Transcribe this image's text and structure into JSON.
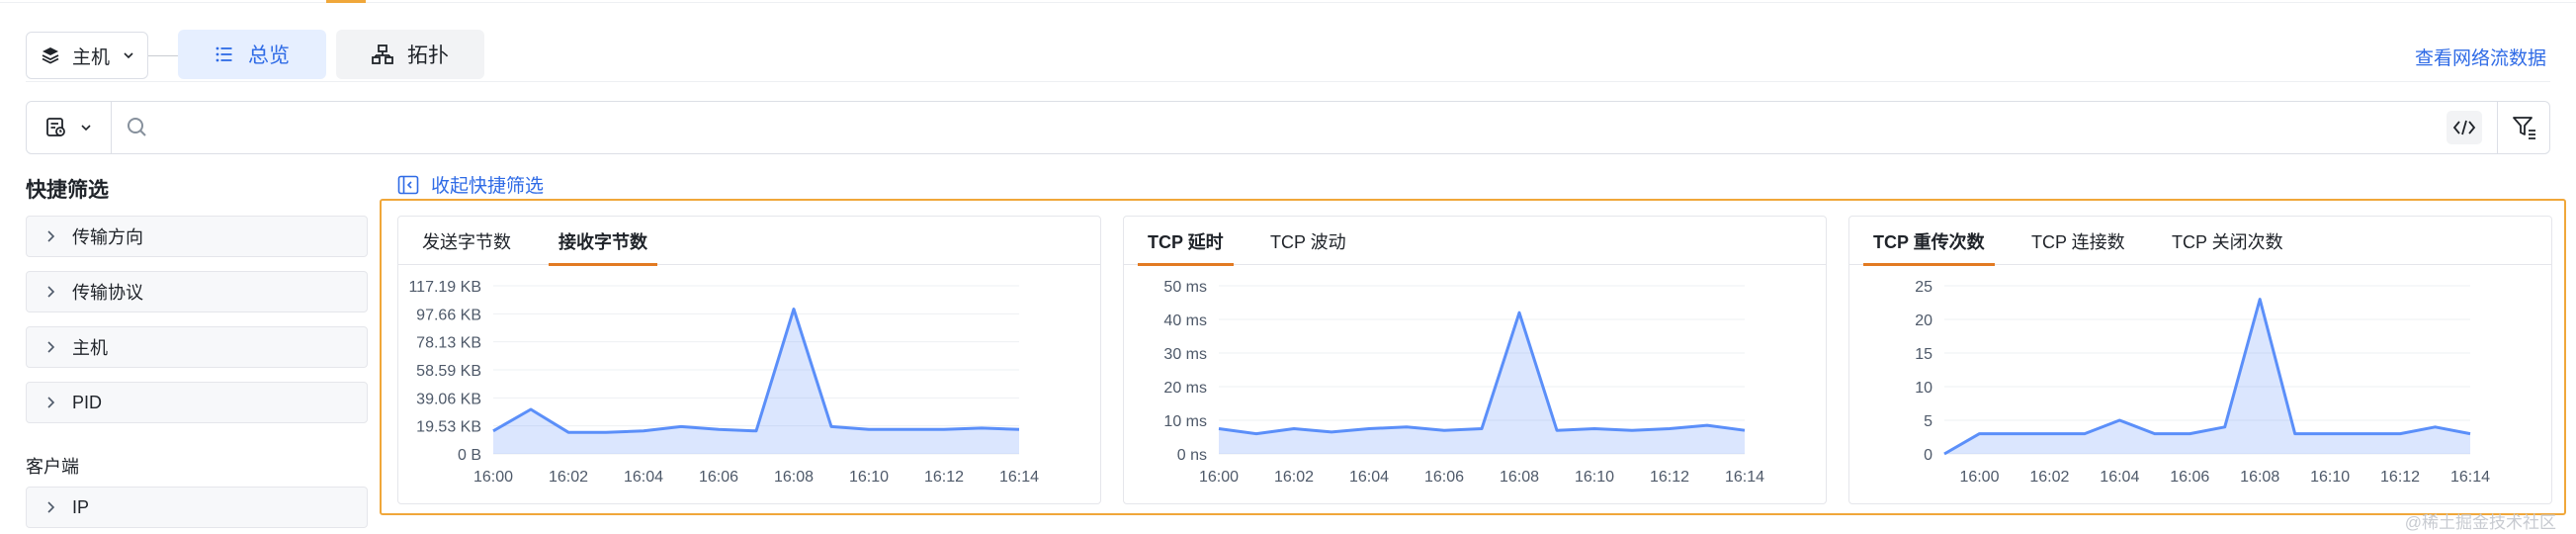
{
  "header": {
    "host_select": "主机",
    "tabs": [
      {
        "label": "总览",
        "active": true
      },
      {
        "label": "拓扑",
        "active": false
      }
    ],
    "flow_link": "查看网络流数据"
  },
  "search": {
    "placeholder": ""
  },
  "sidebar": {
    "title": "快捷筛选",
    "items": [
      {
        "label": "传输方向"
      },
      {
        "label": "传输协议"
      },
      {
        "label": "主机"
      },
      {
        "label": "PID"
      }
    ],
    "client_title": "客户端",
    "client_items": [
      {
        "label": "IP"
      }
    ]
  },
  "collapse_label": "收起快捷筛选",
  "cards": [
    {
      "tabs": [
        {
          "label": "发送字节数",
          "active": false
        },
        {
          "label": "接收字节数",
          "active": true
        }
      ]
    },
    {
      "tabs": [
        {
          "label": "TCP 延时",
          "active": true
        },
        {
          "label": "TCP 波动",
          "active": false
        }
      ]
    },
    {
      "tabs": [
        {
          "label": "TCP 重传次数",
          "active": true
        },
        {
          "label": "TCP 连接数",
          "active": false
        },
        {
          "label": "TCP 关闭次数",
          "active": false
        }
      ]
    }
  ],
  "chart_data": [
    {
      "type": "area",
      "title": "",
      "x": [
        "16:00",
        "16:01",
        "16:02",
        "16:03",
        "16:04",
        "16:05",
        "16:06",
        "16:07",
        "16:08",
        "16:09",
        "16:10",
        "16:11",
        "16:12",
        "16:13",
        "16:14"
      ],
      "y_ticks": [
        "0 B",
        "19.53 KB",
        "39.06 KB",
        "58.59 KB",
        "78.13 KB",
        "97.66 KB",
        "117.19 KB"
      ],
      "x_ticks": [
        "16:00",
        "16:02",
        "16:04",
        "16:06",
        "16:08",
        "16:10",
        "16:12",
        "16:14"
      ],
      "ylim": [
        0,
        117.19
      ],
      "yunit": "KB",
      "series": [
        {
          "values": [
            16,
            31,
            15,
            15,
            16,
            19,
            17,
            16,
            101,
            19,
            17,
            17,
            17,
            18,
            17
          ]
        }
      ],
      "color": "#5b8ff9"
    },
    {
      "type": "area",
      "title": "",
      "x": [
        "16:00",
        "16:01",
        "16:02",
        "16:03",
        "16:04",
        "16:05",
        "16:06",
        "16:07",
        "16:08",
        "16:09",
        "16:10",
        "16:11",
        "16:12",
        "16:13",
        "16:14"
      ],
      "y_ticks": [
        "0 ns",
        "10 ms",
        "20 ms",
        "30 ms",
        "40 ms",
        "50 ms"
      ],
      "x_ticks": [
        "16:00",
        "16:02",
        "16:04",
        "16:06",
        "16:08",
        "16:10",
        "16:12",
        "16:14"
      ],
      "ylim": [
        0,
        50
      ],
      "yunit": "ms",
      "series": [
        {
          "values": [
            7.5,
            6,
            7.5,
            6.5,
            7.5,
            8,
            7,
            7.5,
            42,
            7,
            7.5,
            7,
            7.5,
            8.5,
            7
          ]
        }
      ],
      "color": "#5b8ff9"
    },
    {
      "type": "area",
      "title": "",
      "x": [
        "15:59",
        "16:00",
        "16:01",
        "16:02",
        "16:03",
        "16:04",
        "16:05",
        "16:06",
        "16:07",
        "16:08",
        "16:09",
        "16:10",
        "16:11",
        "16:12",
        "16:13",
        "16:14"
      ],
      "y_ticks": [
        "0",
        "5",
        "10",
        "15",
        "20",
        "25"
      ],
      "x_ticks": [
        "16:00",
        "16:02",
        "16:04",
        "16:06",
        "16:08",
        "16:10",
        "16:12",
        "16:14"
      ],
      "ylim": [
        0,
        25
      ],
      "series": [
        {
          "values": [
            0,
            3,
            3,
            3,
            3,
            5,
            3,
            3,
            4,
            23,
            3,
            3,
            3,
            3,
            4,
            3
          ]
        }
      ],
      "color": "#5b8ff9"
    }
  ],
  "watermark": "@稀土掘金技术社区"
}
